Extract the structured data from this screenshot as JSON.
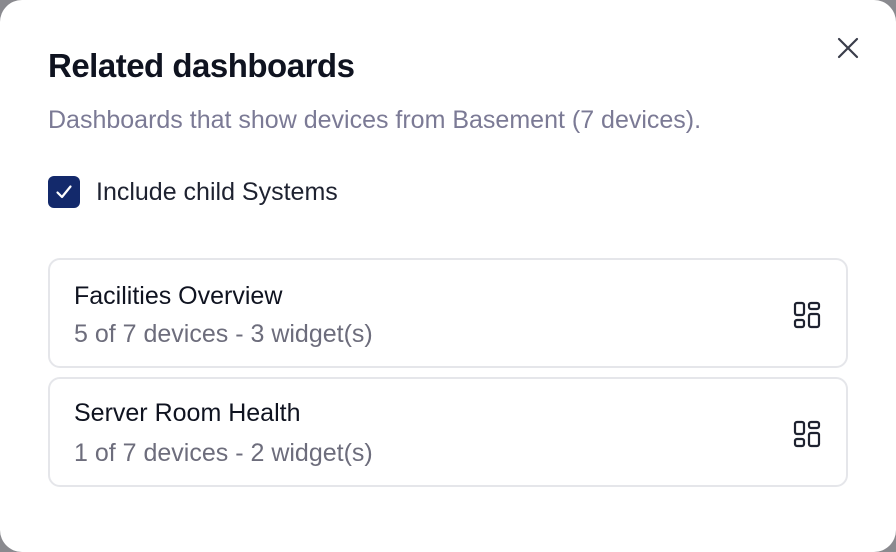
{
  "dialog": {
    "title": "Related dashboards",
    "subtitle": "Dashboards that show devices from Basement (7 devices).",
    "close_icon": "close-icon"
  },
  "include_child": {
    "checked": true,
    "label": "Include child Systems"
  },
  "dashboards": [
    {
      "name": "Facilities Overview",
      "meta": "5 of 7 devices - 3 widget(s)",
      "icon": "dashboard-grid-icon"
    },
    {
      "name": "Server Room Health",
      "meta": "1 of 7 devices - 2 widget(s)",
      "icon": "dashboard-grid-icon"
    }
  ],
  "colors": {
    "accent": "#13296b",
    "subtitle": "#7b7a95",
    "border": "#e5e6ea"
  }
}
